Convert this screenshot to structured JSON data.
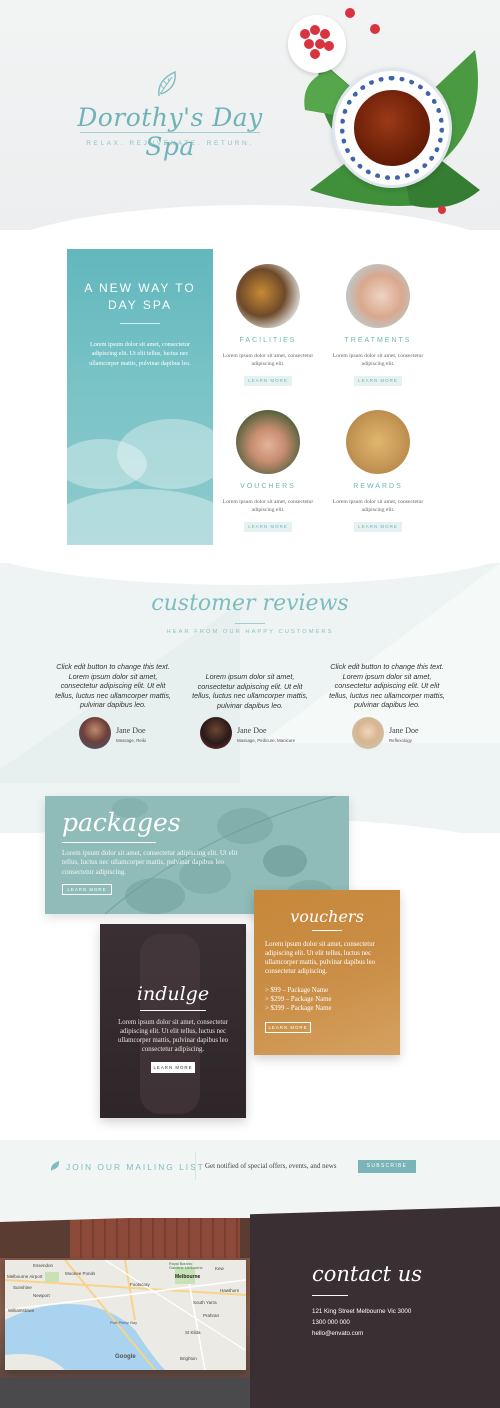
{
  "hero": {
    "title": "Dorothy's Day Spa",
    "tagline": "RELAX. REJUVENATE. RETURN."
  },
  "intro": {
    "title": "A NEW WAY TO DAY SPA",
    "text": "Lorem ipsum dolor sit amet, consectetur adipiscing elit. Ut elit tellus, luctus nec ullamcorper mattis, pulvinar dapibus leo."
  },
  "services": [
    {
      "title": "FACILITIES",
      "text": "Lorem ipsum dolor sit amet, consectetur adipiscing elit.",
      "button": "LEARN MORE"
    },
    {
      "title": "TREATMENTS",
      "text": "Lorem ipsum dolor sit amet, consectetur adipiscing elit.",
      "button": "LEARN MORE"
    },
    {
      "title": "VOUCHERS",
      "text": "Lorem ipsum dolor sit amet, consectetur adipiscing elit.",
      "button": "LEARN MORE"
    },
    {
      "title": "REWARDS",
      "text": "Lorem ipsum dolor sit amet, consectetur adipiscing elit.",
      "button": "LEARN MORE"
    }
  ],
  "reviews": {
    "title": "customer reviews",
    "subtitle": "HEAR FROM OUR HAPPY CUSTOMERS",
    "items": [
      {
        "text": "Click edit button to change this text. Lorem ipsum dolor sit amet, consectetur adipiscing elit. Ut elit tellus, luctus nec ullamcorper mattis, pulvinar dapibus leo.",
        "name": "Jane Doe",
        "role": "Massage, Reiki"
      },
      {
        "text": "Lorem ipsum dolor sit amet, consectetur adipiscing elit. Ut elit tellus, luctus nec ullamcorper mattis, pulvinar dapibus leo.",
        "name": "Jane Doe",
        "role": "Massage, Pedicure, Manicure"
      },
      {
        "text": "Click edit button to change this text. Lorem ipsum dolor sit amet, consectetur adipiscing elit. Ut elit tellus, luctus nec ullamcorper mattis, pulvinar dapibus leo.",
        "name": "Jane Doe",
        "role": "Reflexology"
      }
    ]
  },
  "packages": {
    "title": "packages",
    "text": "Lorem ipsum dolor sit amet, consectetur adipiscing elit. Ut elit tellus, luctus nec ullamcorper mattis, pulvinar dapibus leo consectetur adipiscing.",
    "button": "LEARN MORE"
  },
  "vouchers": {
    "title": "vouchers",
    "text": "Lorem ipsum dolor sit amet, consectetur adipiscing elit. Ut elit tellus, luctus nec ullamcorper mattis, pulvinar dapibus leo consectetur adipiscing.",
    "items": [
      "> $99 – Package Name",
      "> $299 – Package Name",
      "> $399 – Package Name"
    ],
    "button": "LEARN MORE"
  },
  "indulge": {
    "title": "indulge",
    "text": "Lorem ipsum dolor sit amet, consectetur adipiscing elit. Ut elit tellus, luctus nec ullamcorper mattis, pulvinar dapibus leo consectetur adipiscing.",
    "button": "LEARN MORE"
  },
  "mailing": {
    "label": "JOIN OUR MAILING LIST",
    "text": "Get notified of special offers, events, and news",
    "button": "SUBSCRIBE"
  },
  "contact": {
    "title": "contact us",
    "address": "121 King Street Melbourne Vic 3000",
    "phone": "1300 000 000",
    "email": "hello@envato.com"
  },
  "map": {
    "brand": "Google",
    "labels": [
      "Essendon",
      "Moonee Ponds",
      "Melbourne Airport",
      "Sunshine",
      "Footscray",
      "Newport",
      "Williamstown",
      "Port Phillip Bay",
      "Melbourne",
      "South Yarra",
      "St Kilda",
      "Brighton",
      "Prahran",
      "Kew",
      "Hawthorn",
      "Royal Botanic Gardens Melbourne"
    ]
  },
  "colors": {
    "accent": "#6fb3b8",
    "teal_card": "#62b7bd",
    "voucher_card": "#c8883a",
    "dark_card": "#2f2629",
    "contact_bg": "#3a2f33"
  }
}
